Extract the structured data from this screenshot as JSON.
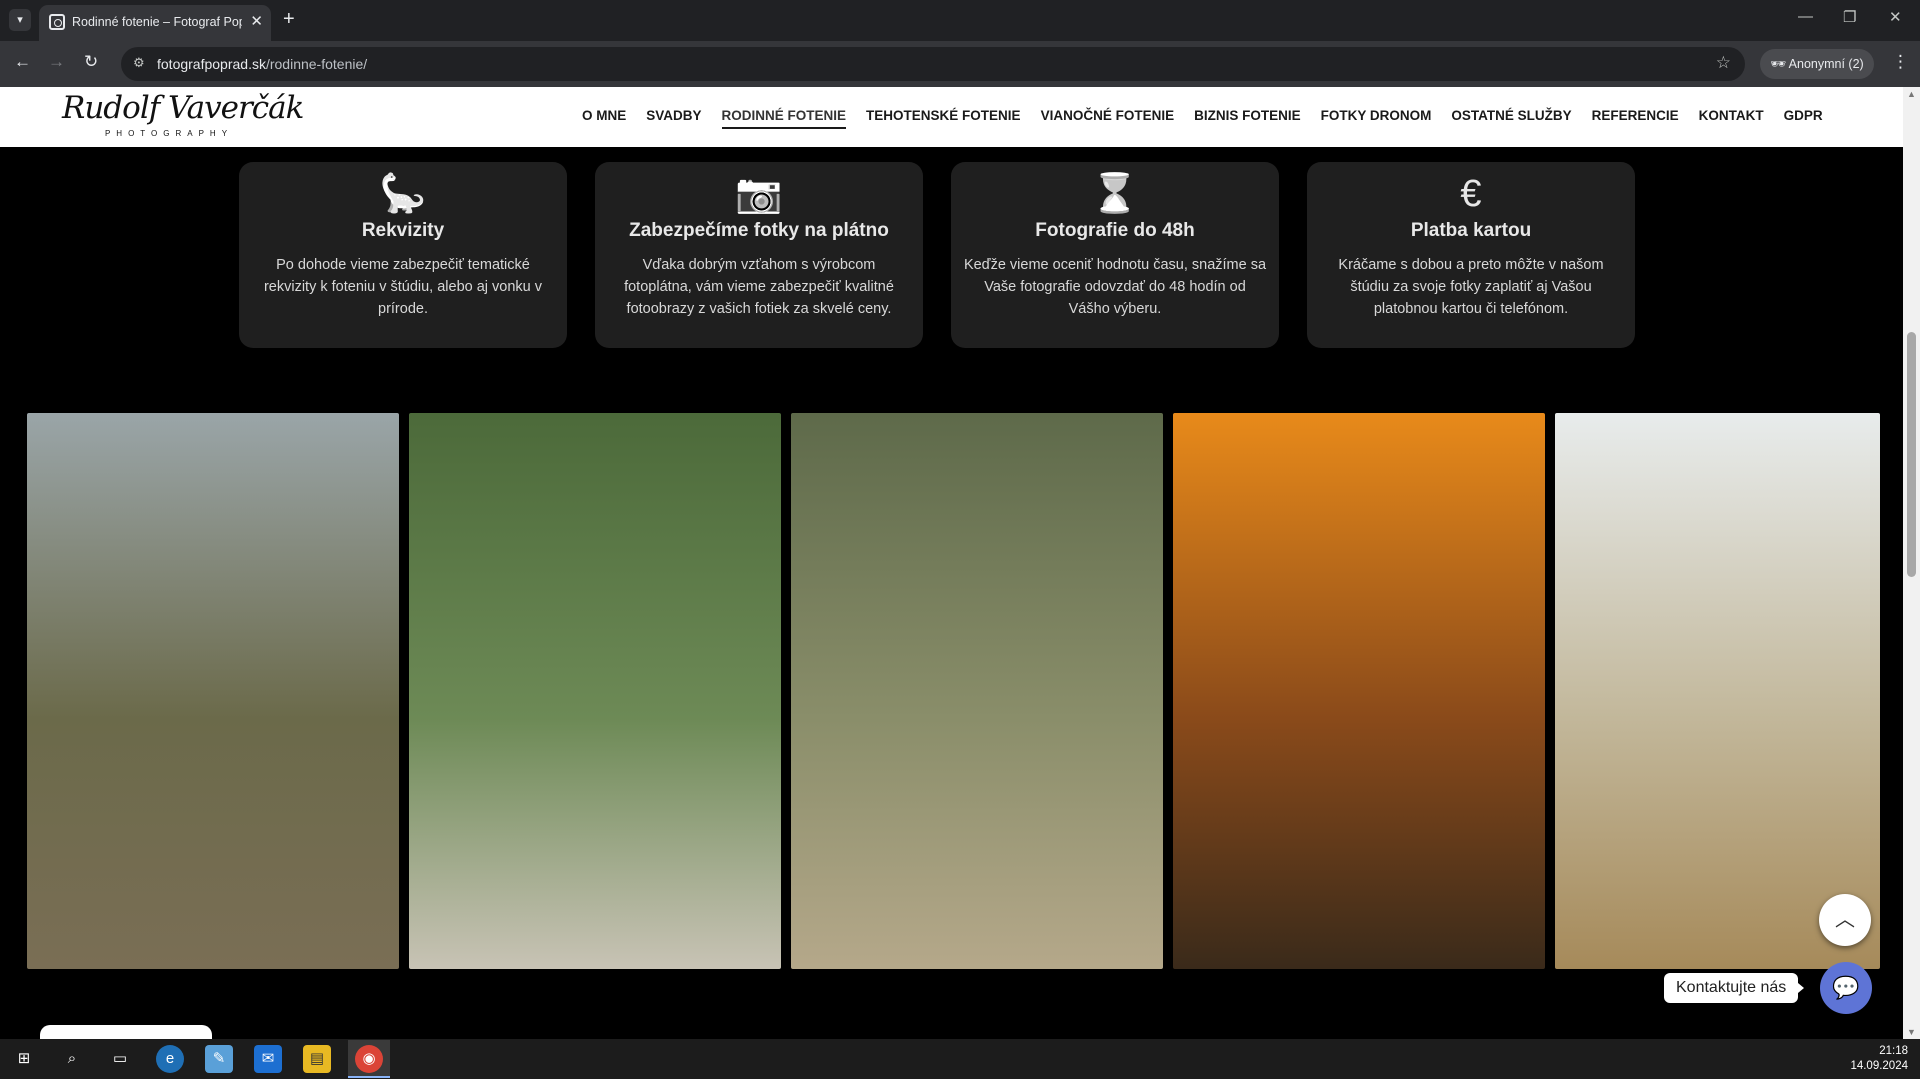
{
  "browser": {
    "tab_title": "Rodinné fotenie – Fotograf Poprad",
    "url_domain": "fotografpoprad.sk",
    "url_path": "/rodinne-fotenie/",
    "profile_label": "Anonymní (2)",
    "icons": {
      "tab_search": "chevron-down-icon",
      "back": "arrow-left-icon",
      "forward": "arrow-right-icon",
      "reload": "reload-icon",
      "site_info": "tune-icon",
      "bookmark": "star-icon",
      "menu": "kebab-icon"
    }
  },
  "site": {
    "logo_signature": "Rudolf Vaverčák",
    "logo_subtitle": "PHOTOGRAPHY",
    "menu": [
      {
        "label": "O MNE",
        "active": false
      },
      {
        "label": "SVADBY",
        "active": false
      },
      {
        "label": "RODINNÉ FOTENIE",
        "active": true
      },
      {
        "label": "TEHOTENSKÉ FOTENIE",
        "active": false
      },
      {
        "label": "VIANOČNÉ FOTENIE",
        "active": false
      },
      {
        "label": "BIZNIS FOTENIE",
        "active": false
      },
      {
        "label": "FOTKY DRONOM",
        "active": false
      },
      {
        "label": "OSTATNÉ SLUŽBY",
        "active": false
      },
      {
        "label": "REFERENCIE",
        "active": false
      },
      {
        "label": "KONTAKT",
        "active": false
      },
      {
        "label": "GDPR",
        "active": false
      }
    ]
  },
  "features": [
    {
      "icon": "dinosaur-toy-icon",
      "title": "Rekvizity",
      "text": "Po dohode vieme zabezpečiť tematické rekvizity k foteniu v štúdiu, alebo aj vonku v prírode."
    },
    {
      "icon": "camera-icon",
      "title": "Zabezpečíme fotky na plátno",
      "text": "Vďaka dobrým vzťahom s výrobcom fotoplátna, vám vieme zabezpečiť kvalitné fotoobrazy z vašich fotiek za skvelé ceny."
    },
    {
      "icon": "hourglass-icon",
      "title": "Fotografie do 48h",
      "text": "Keďže vieme oceniť hodnotu času, snažíme sa Vaše fotografie odovzdať do 48 hodín od Vášho výberu."
    },
    {
      "icon": "euro-icon",
      "title": "Platba kartou",
      "text": "Kráčame s dobou a preto môžte v našom štúdiu za svoje fotky zaplatiť aj Vašou platobnou kartou či telefónom."
    }
  ],
  "gallery": [
    {
      "alt": "family-photo-1",
      "colors": [
        "#9aa5a8",
        "#6b6a4a",
        "#7a6e55"
      ]
    },
    {
      "alt": "family-photo-2",
      "colors": [
        "#4c6a3a",
        "#6d8a56",
        "#c8c3b5"
      ]
    },
    {
      "alt": "family-photo-3",
      "colors": [
        "#5e6a4a",
        "#8a8e6a",
        "#b5a88a"
      ]
    },
    {
      "alt": "family-photo-4",
      "colors": [
        "#e88a1a",
        "#8a4a1a",
        "#3a2a1a"
      ]
    },
    {
      "alt": "family-photo-5",
      "colors": [
        "#e8ecec",
        "#c2b79a",
        "#a68a5a"
      ]
    }
  ],
  "widgets": {
    "contact_label": "Kontaktujte nás",
    "scroll_top_icon": "chevron-up-icon",
    "contact_icon": "chat-bubble-icon"
  },
  "taskbar": {
    "time": "21:18",
    "date": "14.09.2024"
  }
}
